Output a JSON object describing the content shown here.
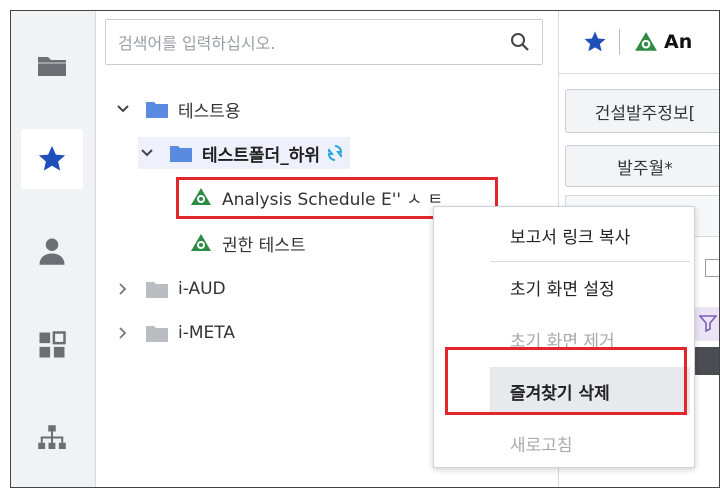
{
  "search": {
    "placeholder": "검색어를 입력하십시오."
  },
  "rail": {
    "items": [
      {
        "icon": "folder-icon"
      },
      {
        "icon": "star-icon",
        "active": true
      },
      {
        "icon": "user-icon"
      },
      {
        "icon": "dashboard-icon"
      },
      {
        "icon": "org-chart-icon"
      }
    ]
  },
  "tree": {
    "items": [
      {
        "label": "테스트용",
        "expanded": true,
        "type": "folder"
      },
      {
        "label": "테스트폴더_하위",
        "expanded": true,
        "type": "folder",
        "selected": true
      },
      {
        "label": "Analysis Schedule E'' ㅅ ㅌ",
        "type": "report",
        "highlighted": true
      },
      {
        "label": "권한 테스트",
        "type": "report"
      },
      {
        "label": "i-AUD",
        "expanded": false,
        "type": "folder-gray"
      },
      {
        "label": "i-META",
        "expanded": false,
        "type": "folder-gray"
      }
    ]
  },
  "header": {
    "title": "An"
  },
  "right_panel": {
    "button1": "건설발주정보[",
    "button2": "발주월*"
  },
  "context_menu": {
    "items": [
      {
        "label": "보고서 링크 복사",
        "disabled": false
      },
      {
        "label": "초기 화면 설정",
        "disabled": false
      },
      {
        "label": "초기 화면 제거",
        "disabled": true
      },
      {
        "label": "즐겨찾기 삭제",
        "disabled": false,
        "highlighted": true
      },
      {
        "label": "새로고침",
        "disabled": true
      }
    ]
  },
  "colors": {
    "accent_blue": "#3b66c9",
    "folder_blue": "#5a8be0",
    "report_green": "#2e8b45",
    "highlight_red": "#e3262b"
  }
}
